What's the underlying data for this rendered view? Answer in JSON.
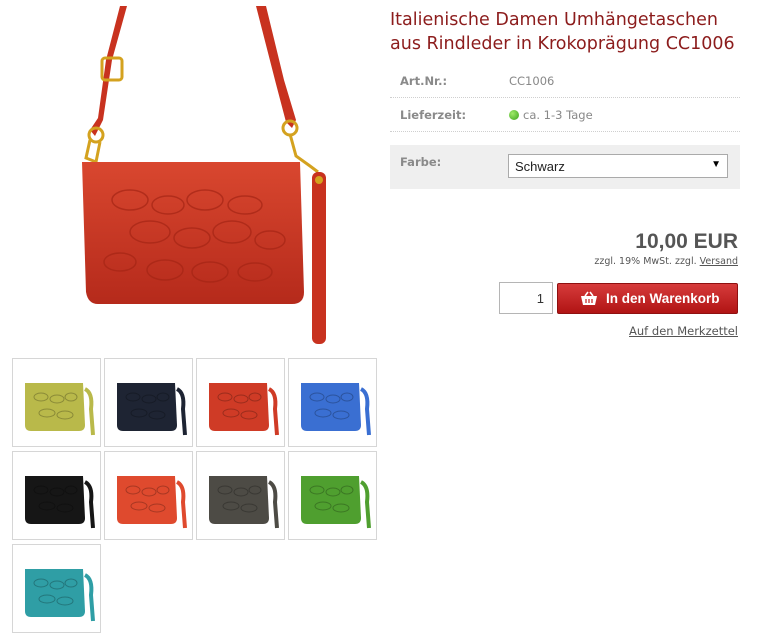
{
  "product": {
    "title_line1": "Italienische Damen Umhängetaschen",
    "title_line2": "aus Rindleder in Krokoprägung CC1006"
  },
  "details": {
    "art_label": "Art.Nr.:",
    "art_value": "CC1006",
    "delivery_label": "Lieferzeit:",
    "delivery_value": "ca. 1-3 Tage"
  },
  "options": {
    "color_label": "Farbe:",
    "color_selected": "Schwarz"
  },
  "pricing": {
    "price": "10,00 EUR",
    "tax_text": "zzgl. 19% MwSt. zzgl.",
    "shipping_link": "Versand"
  },
  "cart": {
    "quantity": "1",
    "button_label": "In den Warenkorb",
    "wishlist_link": "Auf den Merkzettel"
  },
  "colors": {
    "title": "#8c1c1c",
    "button": "#c42020",
    "main_bag": "#cf3b26"
  },
  "thumbnails": [
    {
      "color": "#b9b94a",
      "name": "olive"
    },
    {
      "color": "#1e2433",
      "name": "navy"
    },
    {
      "color": "#cf3b26",
      "name": "red"
    },
    {
      "color": "#3a6fd2",
      "name": "blue"
    },
    {
      "color": "#161616",
      "name": "black"
    },
    {
      "color": "#df4a2e",
      "name": "orange-red"
    },
    {
      "color": "#4d4b45",
      "name": "grey"
    },
    {
      "color": "#4f9f2f",
      "name": "green"
    },
    {
      "color": "#2f9ea5",
      "name": "teal"
    }
  ]
}
